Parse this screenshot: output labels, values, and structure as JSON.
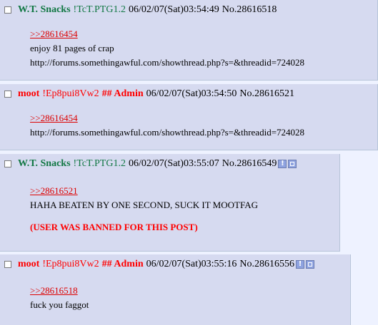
{
  "posts": [
    {
      "name": "W.T. Snacks",
      "tripcode": "!TcT.PTG1.2",
      "capcode": "",
      "datetime": "06/02/07(Sat)03:54:49",
      "number": "No.28616518",
      "quote": ">>28616454",
      "lines": [
        "enjoy 81 pages of crap",
        "http://forums.somethingawful.com/showthread.php?s=&threadid=724028"
      ],
      "ban_message": ""
    },
    {
      "name": "moot",
      "tripcode": "!Ep8pui8Vw2",
      "capcode": "## Admin",
      "datetime": "06/02/07(Sat)03:54:50",
      "number": "No.28616521",
      "quote": ">>28616454",
      "lines": [
        "http://forums.somethingawful.com/showthread.php?s=&threadid=724028"
      ],
      "ban_message": ""
    },
    {
      "name": "W.T. Snacks",
      "tripcode": "!TcT.PTG1.2",
      "capcode": "",
      "datetime": "06/02/07(Sat)03:55:07",
      "number": "No.28616549",
      "quote": ">>28616521",
      "lines": [
        "HAHA BEATEN BY ONE SECOND, SUCK IT MOOTFAG"
      ],
      "ban_message": "(USER WAS BANNED FOR THIS POST)"
    },
    {
      "name": "moot",
      "tripcode": "!Ep8pui8Vw2",
      "capcode": "## Admin",
      "datetime": "06/02/07(Sat)03:55:16",
      "number": "No.28616556",
      "quote": ">>28616518",
      "lines": [
        "fuck you faggot"
      ],
      "ban_message": ""
    }
  ],
  "icons": {
    "info": "info-icon",
    "image": "image-icon"
  },
  "colors": {
    "post_bg": "#d6daf0",
    "page_bg": "#eef2ff",
    "name_green": "#117743",
    "admin_red": "#ff0000",
    "quote_red": "#dd0000"
  }
}
